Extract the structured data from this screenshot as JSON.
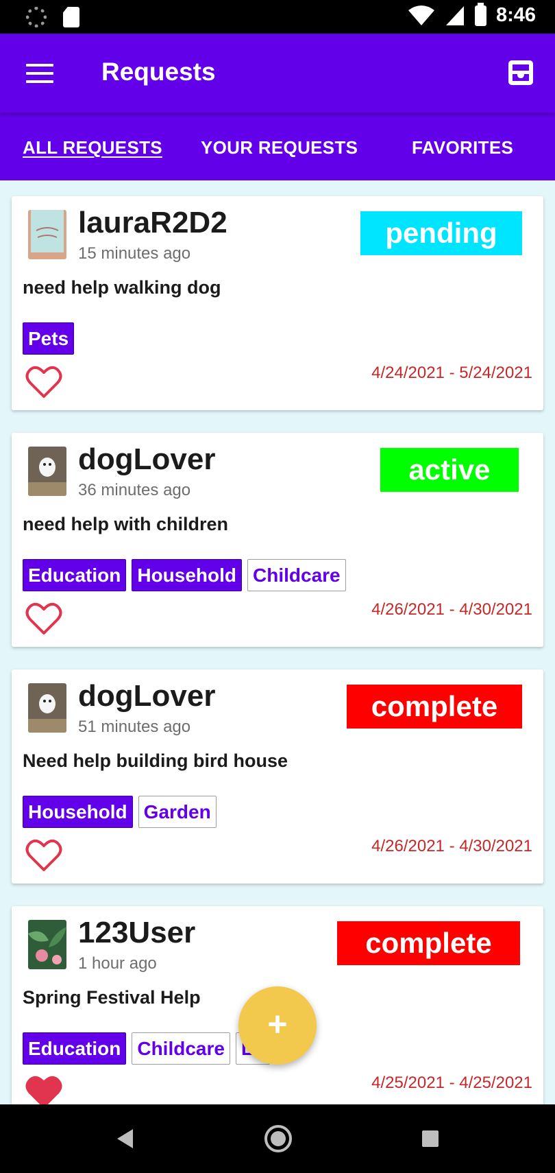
{
  "status_bar": {
    "time": "8:46",
    "icons": [
      "loading-icon",
      "sd-card-icon",
      "wifi-icon",
      "signal-icon",
      "battery-icon"
    ]
  },
  "app_bar": {
    "title": "Requests",
    "icons": [
      "menu-icon",
      "inbox-icon"
    ]
  },
  "tabs": [
    {
      "label": "ALL REQUESTS",
      "active": true
    },
    {
      "label": "YOUR REQUESTS",
      "active": false
    },
    {
      "label": "FAVORITES",
      "active": false
    }
  ],
  "requests": [
    {
      "username": "lauraR2D2",
      "time_ago": "15 minutes ago",
      "status": "pending",
      "description": "need help walking dog",
      "tags": [
        "Pets"
      ],
      "date_range": "4/24/2021 - 5/24/2021",
      "favorited": false
    },
    {
      "username": "dogLover",
      "time_ago": "36 minutes ago",
      "status": "active",
      "description": "need help with children",
      "tags": [
        "Education",
        "Household",
        "Childcare"
      ],
      "date_range": "4/26/2021 - 4/30/2021",
      "favorited": false
    },
    {
      "username": "dogLover",
      "time_ago": "51 minutes ago",
      "status": "complete",
      "description": "Need help building bird house",
      "tags": [
        "Household",
        "Garden"
      ],
      "date_range": "4/26/2021 - 4/30/2021",
      "favorited": false
    },
    {
      "username": "123User",
      "time_ago": "1 hour ago",
      "status": "complete",
      "description": "Spring Festival Help",
      "tags": [
        "Education",
        "Childcare",
        "Lo"
      ],
      "date_range": "4/25/2021 - 4/25/2021",
      "favorited": true
    }
  ],
  "fab": {
    "label": "+"
  },
  "colors": {
    "primary": "#6200ea",
    "pending": "#00e5ff",
    "active": "#00ff00",
    "complete": "#ff0000",
    "heart": "#e0344f",
    "date": "#c62828",
    "fab": "#f2c94c"
  }
}
